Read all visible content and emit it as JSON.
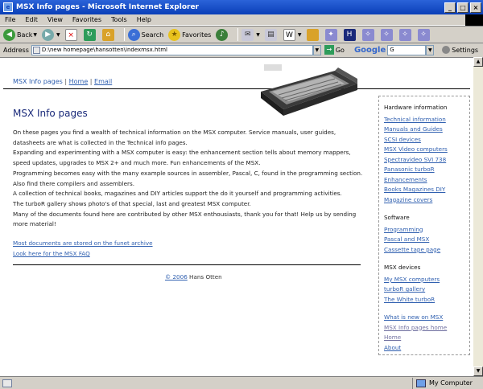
{
  "window": {
    "title": "MSX Info pages - Microsoft Internet Explorer"
  },
  "menu": [
    "File",
    "Edit",
    "View",
    "Favorites",
    "Tools",
    "Help"
  ],
  "toolbar": {
    "back": "Back",
    "search": "Search",
    "favorites": "Favorites"
  },
  "address": {
    "label": "Address",
    "url": "D:\\new homepage\\hansotten\\indexmsx.html",
    "go": "Go"
  },
  "google": {
    "logo": "Google",
    "input": "G"
  },
  "settings": "Settings",
  "status": {
    "zone": "My Computer"
  },
  "colors": {
    "link": "#3060b0",
    "title": "#1a2a7a",
    "titlebar": "#0a3fb8"
  },
  "page": {
    "nav": {
      "info": "MSX Info pages",
      "sep1": " | ",
      "home": "Home",
      "sep2": " | ",
      "email": "Email"
    },
    "title": "MSX Info pages",
    "paragraphs": [
      "On these pages you find a wealth of technical information on the MSX computer. Service manuals, user guides, datasheets are what is collected in the Technical info pages.",
      "Expanding and experimenting with a MSX computer is easy: the enhancement section tells about memory mappers, speed updates, upgrades to MSX 2+ and much more. Fun enhancements of the MSX.",
      "Programming becomes easy with the many example sources in assembler, Pascal, C,  found in the programming section. Also find there compilers and assemblers.",
      "A collection of technical books, magazines and DIY articles support the do it yourself and programming activities.",
      "The turboR gallery shows photo's of that special, last and greatest MSX computer.",
      "Many of the documents found here are contributed by other MSX enthousiasts, thank you for that! Help us by sending more material!"
    ],
    "links": [
      "Most documents are stored on the funet archive",
      "Look here for the MSX FAQ"
    ],
    "footer": {
      "copy": "© 2006",
      "author": " Hans Otten"
    }
  },
  "sidebar": {
    "hw_title": "Hardware information",
    "hw_links": [
      "Technical information",
      "Manuals and Guides",
      "SCSI devices",
      "MSX Video computers",
      "Spectravideo SVI 738",
      "Panasonic turboR",
      "Enhancements",
      "Books Magazines DIY",
      "Magazine covers"
    ],
    "sw_title": "Software",
    "sw_links": [
      "Programming",
      "Pascal and MSX",
      "Cassette tape page"
    ],
    "dev_title": "MSX devices",
    "dev_links": [
      "My MSX computers",
      "turboR gallery",
      "The White turboR"
    ],
    "misc_links": [
      "What is new on MSX",
      "MSX Info pages home",
      "Home",
      "About"
    ]
  }
}
